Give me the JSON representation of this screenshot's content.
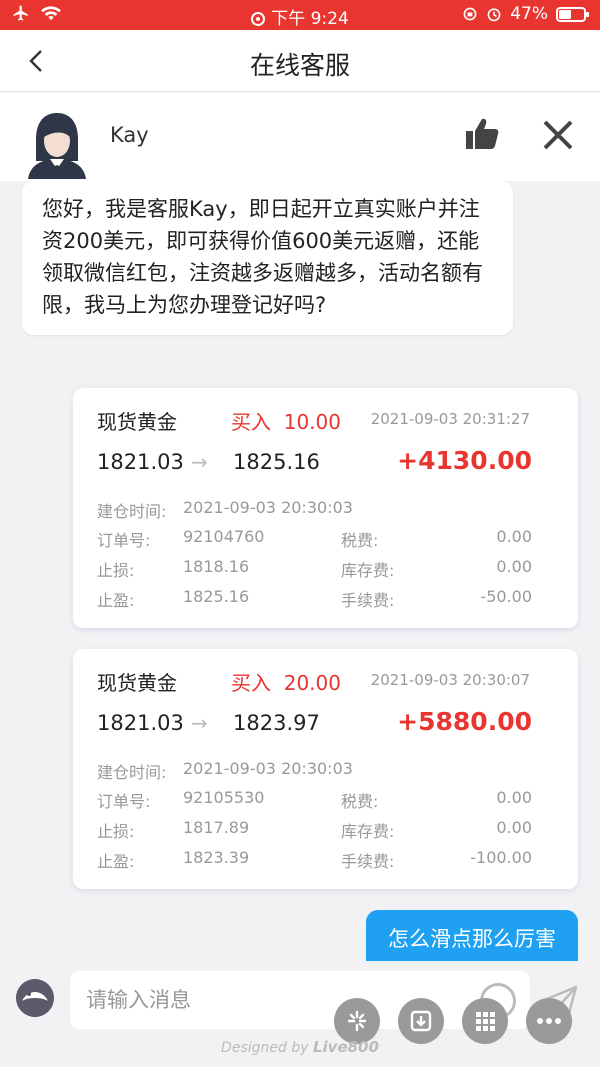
{
  "status_bar": {
    "time": "下午 9:24",
    "battery": "47%"
  },
  "nav": {
    "title": "在线客服"
  },
  "agent": {
    "name": "Kay"
  },
  "messages": {
    "agent_greeting": "您好，我是客服Kay，即日起开立真实账户并注资200美元，即可获得价值600美元返赠，还能领取微信红包，注资越多返赠越多，活动名额有限，我马上为您办理登记好吗?",
    "user_reply": "怎么滑点那么厉害"
  },
  "trades": [
    {
      "product": "现货黄金",
      "side": "买入",
      "qty": "10.00",
      "time": "2021-09-03 20:31:27",
      "open_price": "1821.03",
      "close_price": "1825.16",
      "profit": "+4130.00",
      "open_time_label": "建仓时间:",
      "open_time": "2021-09-03 20:30:03",
      "order_label": "订单号:",
      "order_no": "92104760",
      "sl_label": "止损:",
      "stop_loss": "1818.16",
      "tp_label": "止盈:",
      "take_profit": "1825.16",
      "tax_label": "税费:",
      "tax": "0.00",
      "storage_label": "库存费:",
      "storage": "0.00",
      "fee_label": "手续费:",
      "fee": "-50.00"
    },
    {
      "product": "现货黄金",
      "side": "买入",
      "qty": "20.00",
      "time": "2021-09-03 20:30:07",
      "open_price": "1821.03",
      "close_price": "1823.97",
      "profit": "+5880.00",
      "open_time_label": "建仓时间:",
      "open_time": "2021-09-03 20:30:03",
      "order_label": "订单号:",
      "order_no": "92105530",
      "sl_label": "止损:",
      "stop_loss": "1817.89",
      "tp_label": "止盈:",
      "take_profit": "1823.39",
      "tax_label": "税费:",
      "tax": "0.00",
      "storage_label": "库存费:",
      "storage": "0.00",
      "fee_label": "手续费:",
      "fee": "-100.00"
    }
  ],
  "input": {
    "placeholder": "请输入消息"
  },
  "footer": {
    "designed_by": "Designed by",
    "brand": "Live800"
  },
  "colors": {
    "status_bar": "#e8352f",
    "user_bubble": "#1fa0f0",
    "profit": "#e8352f"
  }
}
